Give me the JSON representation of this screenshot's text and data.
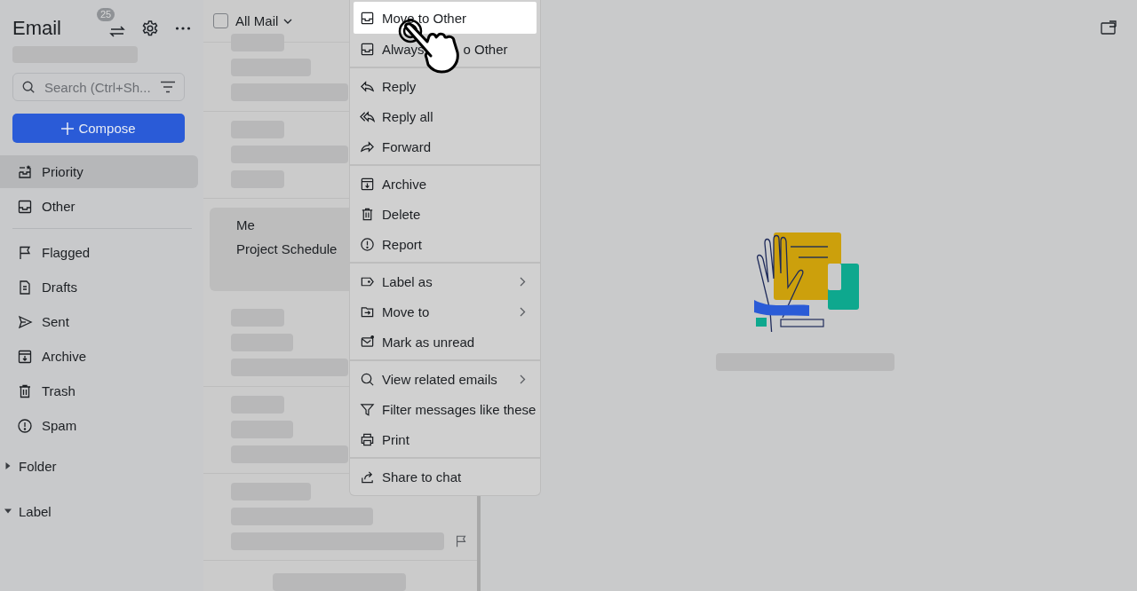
{
  "sidebar": {
    "title": "Email",
    "sort_badge": "25",
    "search": {
      "placeholder": "Search (Ctrl+Sh..."
    },
    "compose": "Compose",
    "groups": [
      [
        {
          "label": "Priority",
          "kind": "priority",
          "selected": true
        },
        {
          "label": "Other",
          "kind": "inbox",
          "selected": false
        }
      ],
      [
        {
          "label": "Flagged",
          "kind": "flag",
          "selected": false
        },
        {
          "label": "Drafts",
          "kind": "draft",
          "selected": false
        },
        {
          "label": "Sent",
          "kind": "sent",
          "selected": false
        },
        {
          "label": "Archive",
          "kind": "archive",
          "selected": false
        },
        {
          "label": "Trash",
          "kind": "trash",
          "selected": false
        },
        {
          "label": "Spam",
          "kind": "spam",
          "selected": false
        }
      ]
    ],
    "sections": [
      {
        "label": "Folder",
        "expanded": false
      },
      {
        "label": "Label",
        "expanded": true
      }
    ]
  },
  "list": {
    "filter": "All Mail",
    "checked": false,
    "rows": [
      {
        "kind": "loading",
        "flagged": false
      },
      {
        "kind": "loading",
        "flagged": false
      },
      {
        "kind": "email",
        "sender": "Me",
        "subject": "Project Schedule",
        "selected": true
      },
      {
        "kind": "loading",
        "flagged": false
      },
      {
        "kind": "loading",
        "flagged": false
      },
      {
        "kind": "loading",
        "flagged": true
      }
    ]
  },
  "menu": [
    [
      {
        "label": "Move to Other",
        "kind": "inbox",
        "hovered": true,
        "submenu": false
      },
      {
        "label": "Always",
        "label_tail": "o Other",
        "kind": "inbox",
        "hovered": false,
        "submenu": false
      }
    ],
    [
      {
        "label": "Reply",
        "kind": "reply",
        "hovered": false,
        "submenu": false
      },
      {
        "label": "Reply all",
        "kind": "replyall",
        "hovered": false,
        "submenu": false
      },
      {
        "label": "Forward",
        "kind": "forward",
        "hovered": false,
        "submenu": false
      }
    ],
    [
      {
        "label": "Archive",
        "kind": "archive",
        "hovered": false,
        "submenu": false
      },
      {
        "label": "Delete",
        "kind": "trash",
        "hovered": false,
        "submenu": false
      },
      {
        "label": "Report",
        "kind": "spam",
        "hovered": false,
        "submenu": false
      }
    ],
    [
      {
        "label": "Label as",
        "kind": "tag",
        "hovered": false,
        "submenu": true
      },
      {
        "label": "Move to",
        "kind": "move",
        "hovered": false,
        "submenu": true
      },
      {
        "label": "Mark as unread",
        "kind": "unread",
        "hovered": false,
        "submenu": false
      }
    ],
    [
      {
        "label": "View related emails",
        "kind": "search",
        "hovered": false,
        "submenu": true
      },
      {
        "label": "Filter messages like these",
        "kind": "filter",
        "hovered": false,
        "submenu": false
      },
      {
        "label": "Print",
        "kind": "print",
        "hovered": false,
        "submenu": false
      }
    ],
    [
      {
        "label": "Share to chat",
        "kind": "share",
        "hovered": false,
        "submenu": false
      }
    ]
  ]
}
